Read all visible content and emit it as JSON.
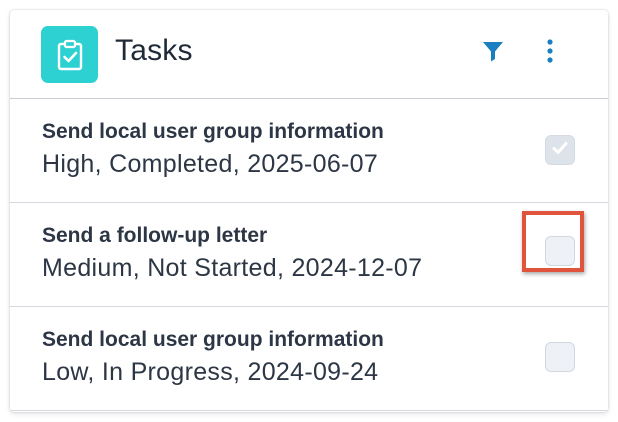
{
  "header": {
    "title": "Tasks",
    "app_icon": "clipboard-check-icon",
    "filter_icon": "filter-icon",
    "more_icon": "more-vertical-icon"
  },
  "tasks": [
    {
      "name": "Send local user group information",
      "meta": "High, Completed, 2025-06-07",
      "completed": true
    },
    {
      "name": "Send a follow-up letter",
      "meta": "Medium, Not Started, 2024-12-07",
      "completed": false,
      "highlighted": true
    },
    {
      "name": "Send local user group information",
      "meta": "Low, In Progress, 2024-09-24",
      "completed": false
    }
  ],
  "colors": {
    "accent": "#2ed1d1",
    "icon_blue": "#1a7fc1",
    "highlight": "#e0533d",
    "text": "#2c3645"
  }
}
